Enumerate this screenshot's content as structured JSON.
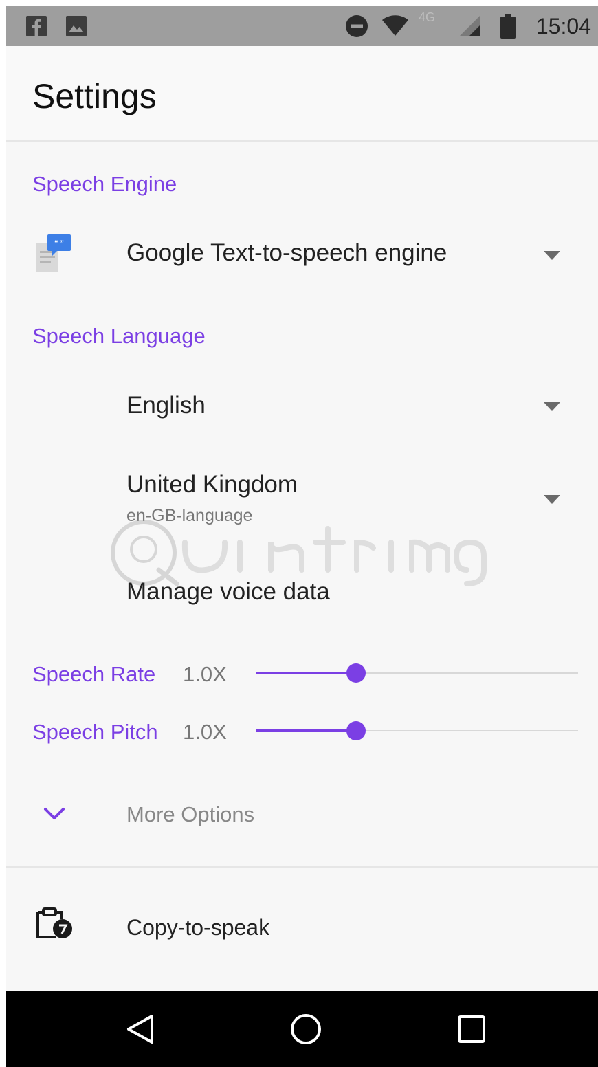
{
  "status_bar": {
    "time": "15:04",
    "network": "4G",
    "left_icons": [
      "facebook-icon",
      "image-icon"
    ],
    "right_icons": [
      "do-not-disturb-icon",
      "wifi-icon",
      "signal-icon",
      "battery-icon"
    ]
  },
  "app_bar": {
    "title": "Settings"
  },
  "speech_engine": {
    "section_label": "Speech Engine",
    "selected": "Google Text-to-speech engine",
    "icon": "tts-engine-icon"
  },
  "speech_language": {
    "section_label": "Speech Language",
    "language": "English",
    "region": "United Kingdom",
    "region_sub": "en-GB-language",
    "manage_voice_data": "Manage voice data"
  },
  "sliders": {
    "rate": {
      "label": "Speech Rate",
      "value_text": "1.0X",
      "value": 1.0,
      "fraction": 0.31
    },
    "pitch": {
      "label": "Speech Pitch",
      "value_text": "1.0X",
      "value": 1.0,
      "fraction": 0.31
    }
  },
  "more_options": {
    "label": "More Options"
  },
  "copy_to_speak": {
    "label": "Copy-to-speak"
  },
  "watermark": "Quantrimang",
  "colors": {
    "accent": "#7b3fe4",
    "status_bar": "#9e9e9e",
    "nav_bar": "#000000"
  }
}
